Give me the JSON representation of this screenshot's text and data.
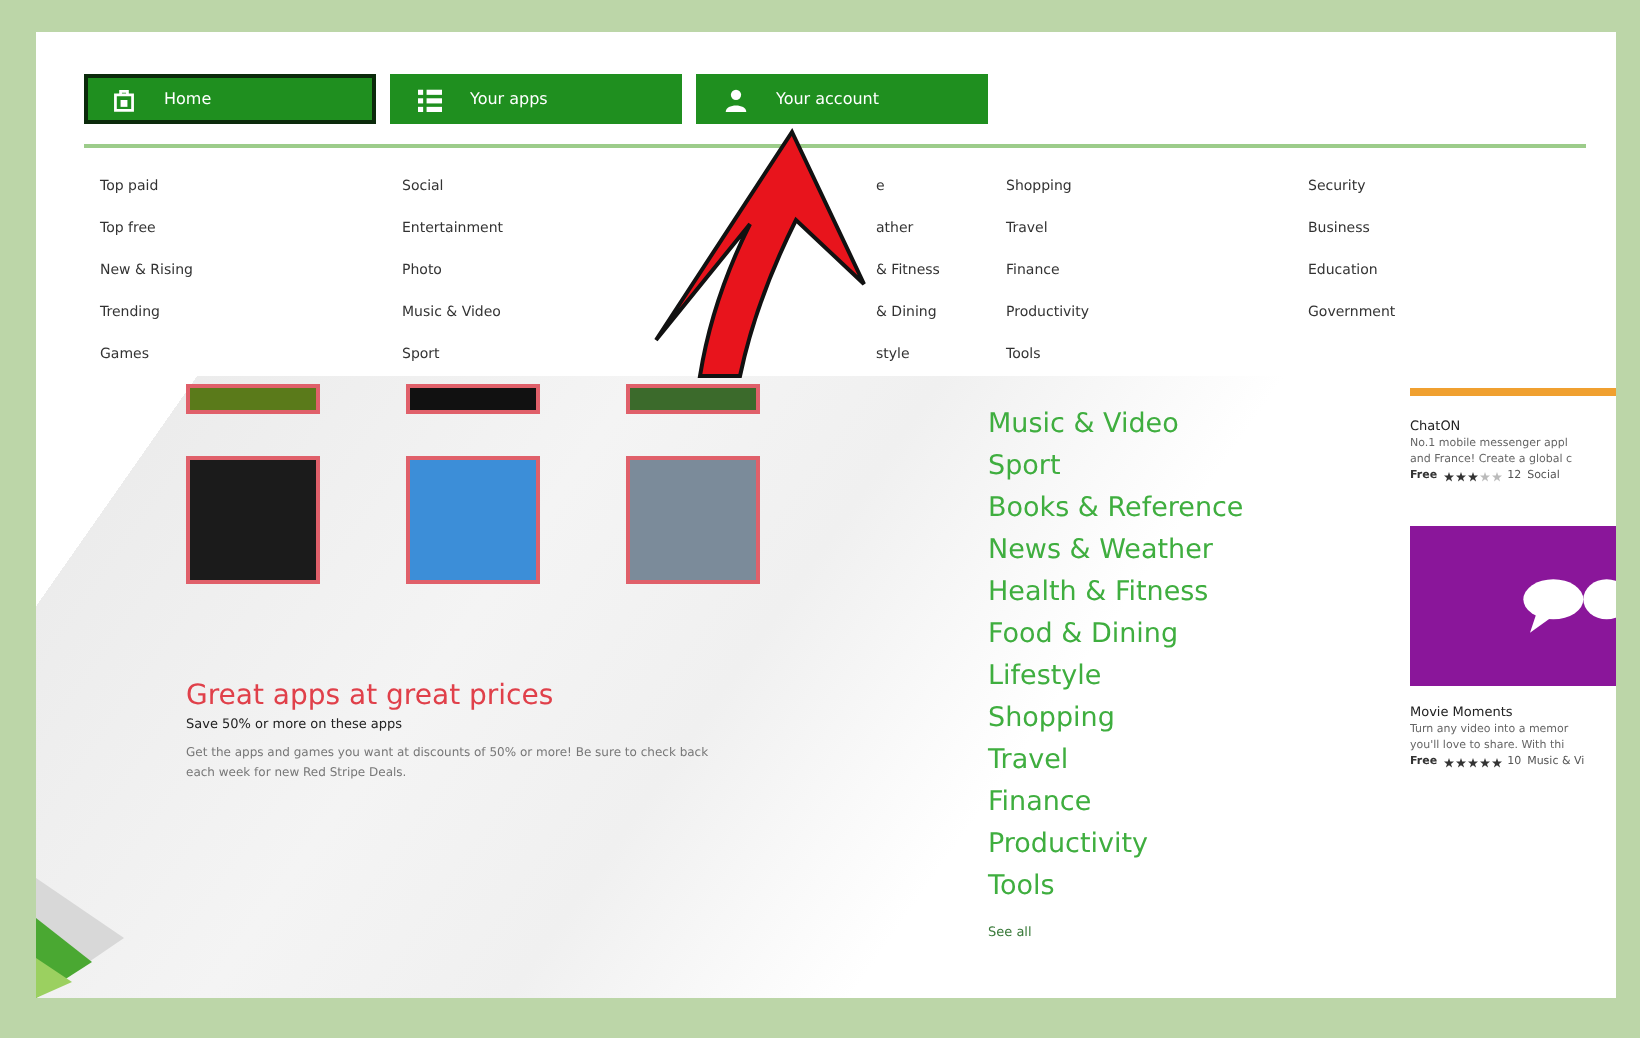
{
  "nav_tabs": [
    {
      "label": "Home",
      "kind": "home",
      "selected": true
    },
    {
      "label": "Your apps",
      "kind": "apps",
      "selected": false
    },
    {
      "label": "Your account",
      "kind": "account",
      "selected": false
    }
  ],
  "menu": {
    "columns": [
      {
        "items": [
          "Top paid",
          "Top free",
          "New & Rising",
          "Trending",
          "Games"
        ]
      },
      {
        "items": [
          "Social",
          "Entertainment",
          "Photo",
          "Music & Video",
          "Sport"
        ]
      },
      {
        "items": [
          "e",
          "ather",
          "& Fitness",
          "& Dining",
          "style"
        ]
      },
      {
        "items": [
          "Shopping",
          "Travel",
          "Finance",
          "Productivity",
          "Tools"
        ]
      },
      {
        "items": [
          "Security",
          "Business",
          "Education",
          "Government"
        ]
      }
    ]
  },
  "promo": {
    "title": "Great apps at great prices",
    "subtitle": "Save 50% or more on these apps",
    "body": "Get the apps and games you want at discounts of 50% or more! Be sure to check back each week for new Red Stripe Deals."
  },
  "categories": [
    "Music & Video",
    "Sport",
    "Books & Reference",
    "News & Weather",
    "Health & Fitness",
    "Food & Dining",
    "Lifestyle",
    "Shopping",
    "Travel",
    "Finance",
    "Productivity",
    "Tools"
  ],
  "see_all": "See all",
  "featured": [
    {
      "kind": "banner",
      "name": "ChatON",
      "description": [
        "No.1 mobile messenger appl",
        "and France! Create a global c"
      ],
      "price": "Free",
      "stars": 3,
      "count": "12",
      "category": "Social"
    },
    {
      "kind": "tile",
      "name": "Movie Moments",
      "description": [
        "Turn any video into a memor",
        "you'll love to share. With thi"
      ],
      "price": "Free",
      "stars": 5,
      "count": "10",
      "category": "Music & Vi"
    }
  ]
}
